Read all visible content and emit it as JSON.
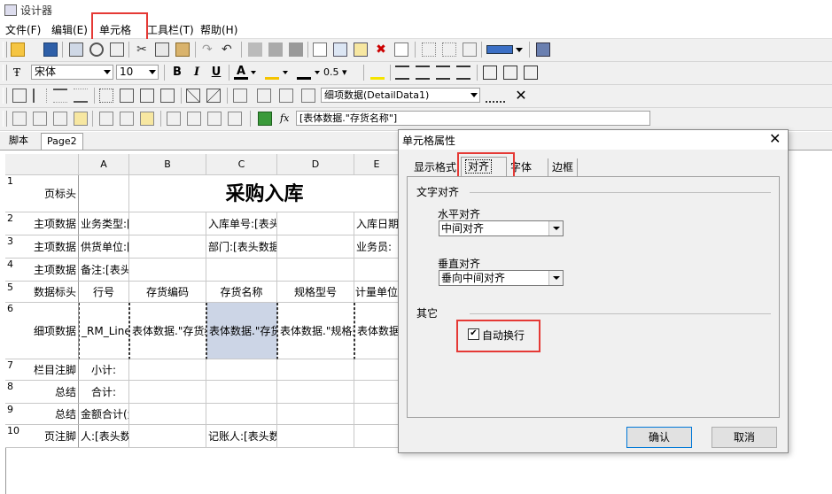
{
  "window": {
    "title": "设计器"
  },
  "menu": {
    "file": "文件(F)",
    "edit": "编辑(E)",
    "cell": "单元格",
    "toolbar": "工具栏(T)",
    "help": "帮助(H)"
  },
  "format": {
    "font_name": "宋体",
    "font_size": "10",
    "bold": "B",
    "italic": "I",
    "underline": "U",
    "font_color": "A",
    "line_width": "0.5"
  },
  "band": {
    "selector": "细项数据(DetailData1)"
  },
  "formula": {
    "fx": "fx",
    "value": "[表体数据.\"存货名称\"]"
  },
  "tabs": {
    "script": "脚本",
    "page2": "Page2"
  },
  "sheet": {
    "columns": [
      "A",
      "B",
      "C",
      "D",
      "E"
    ],
    "rows": [
      {
        "num": "1",
        "band": "页标头",
        "cells": [
          "",
          "采购入库",
          "",
          "",
          ""
        ]
      },
      {
        "num": "2",
        "band": "主项数据",
        "cells": [
          "业务类型:[表头数据.\"",
          "",
          "入库单号:[表头数据.\"入库单号\"]",
          "",
          "入库日期"
        ]
      },
      {
        "num": "3",
        "band": "主项数据",
        "cells": [
          "供货单位:[表头数据.\"",
          "",
          "部门:[表头数据.\"部门\"]",
          "",
          "业务员:"
        ]
      },
      {
        "num": "4",
        "band": "主项数据",
        "cells": [
          "备注:[表头数据.\"备注\"]",
          "",
          "",
          "",
          ""
        ]
      },
      {
        "num": "5",
        "band": "数据标头",
        "cells": [
          "行号",
          "存货编码",
          "存货名称",
          "规格型号",
          "计量单位"
        ]
      },
      {
        "num": "6",
        "band": "细项数据",
        "cells": [
          "_RM_LineNo",
          "表体数据.\"存货编码\"",
          "表体数据.\"存货名称\"",
          "表体数据.\"规格型号\"",
          "表体数据.\""
        ]
      },
      {
        "num": "7",
        "band": "栏目注脚",
        "cells": [
          "小计:",
          "",
          "",
          "",
          ""
        ]
      },
      {
        "num": "8",
        "band": "总结",
        "cells": [
          "合计:",
          "",
          "",
          "",
          ""
        ]
      },
      {
        "num": "9",
        "band": "总结",
        "cells": [
          "金额合计(大写): [CurrToBigNum([FormatFloat('0.00',[S",
          "",
          "",
          "",
          ""
        ]
      },
      {
        "num": "10",
        "band": "页注脚",
        "cells": [
          "人:[表头数据.\"制单人\"]",
          "",
          "记账人:[表头数据.\"记账人\"]",
          "",
          ""
        ]
      }
    ]
  },
  "dialog": {
    "title": "单元格属性",
    "tabs": [
      "显示格式",
      "对齐",
      "字体",
      "边框"
    ],
    "active_tab": "对齐",
    "text_align_group": "文字对齐",
    "h_align_label": "水平对齐",
    "h_align_value": "中间对齐",
    "v_align_label": "垂直对齐",
    "v_align_value": "垂向中间对齐",
    "other_group": "其它",
    "auto_wrap_label": "自动换行",
    "auto_wrap_checked": true,
    "ok": "确认",
    "cancel": "取消"
  },
  "colors": {
    "highlight_red": "#e53935",
    "selected_cell": "#ccd5e6"
  }
}
